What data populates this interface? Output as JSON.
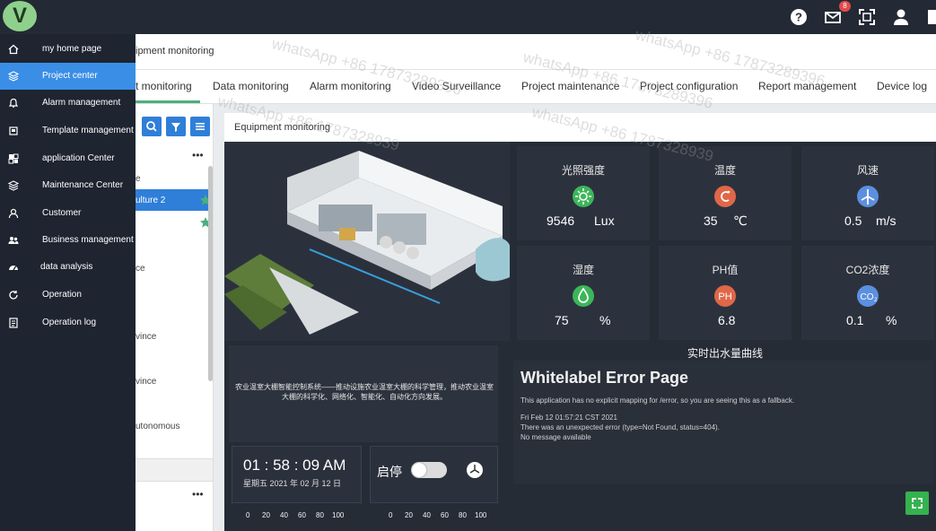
{
  "topbar": {
    "logo": "V",
    "mail_badge": "8",
    "icons": [
      "help-icon",
      "mail-icon",
      "fullscreen-icon",
      "user-icon"
    ]
  },
  "sidebar": {
    "items": [
      {
        "label": "my home page",
        "icon": "home-icon"
      },
      {
        "label": "Project center",
        "icon": "layers-icon",
        "active": true
      },
      {
        "label": "Alarm management",
        "icon": "bell-icon"
      },
      {
        "label": "Template management",
        "icon": "template-icon"
      },
      {
        "label": "application Center",
        "icon": "grid-icon"
      },
      {
        "label": "Maintenance Center",
        "icon": "stack-icon"
      },
      {
        "label": "Customer",
        "icon": "person-icon"
      },
      {
        "label": "Business management",
        "icon": "group-icon"
      },
      {
        "label": "data analysis",
        "icon": "dashboard-icon"
      },
      {
        "label": "Operation",
        "icon": "refresh-icon"
      },
      {
        "label": "Operation log",
        "icon": "log-icon"
      }
    ]
  },
  "breadcrumb": "ipment monitoring",
  "tabs": [
    {
      "label": "t monitoring",
      "active": true
    },
    {
      "label": "Data monitoring"
    },
    {
      "label": "Alarm monitoring"
    },
    {
      "label": "Video Surveillance"
    },
    {
      "label": "Project maintenance"
    },
    {
      "label": "Project configuration"
    },
    {
      "label": "Report management"
    },
    {
      "label": "Device log"
    }
  ],
  "tree": {
    "more": "•••",
    "items": [
      "e",
      "ulture 2",
      "ce",
      "vince",
      "vince",
      "utonomous"
    ]
  },
  "equipment": {
    "title": "Equipment monitoring",
    "scene_caption": "农业温室大棚智能控制系统——推动设施农业温室大棚的科学管理，推动农业温室大棚的科学化、网络化、智能化、自动化方向发展。",
    "sensors": [
      {
        "title": "光照强度",
        "value": "9546",
        "unit": "Lux",
        "icon": "sun-icon",
        "color": "#3cb65a"
      },
      {
        "title": "温度",
        "value": "35",
        "unit": "℃",
        "icon": "thermo-icon",
        "color": "#e06748"
      },
      {
        "title": "风速",
        "value": "0.5",
        "unit": "m/s",
        "icon": "windmill-icon",
        "color": "#5b8fe0"
      },
      {
        "title": "湿度",
        "value": "75",
        "unit": "%",
        "icon": "drop-icon",
        "color": "#3cb65a"
      },
      {
        "title": "PH值",
        "value": "6.8",
        "unit": "",
        "icon": "ph-icon",
        "color": "#e06748"
      },
      {
        "title": "CO2浓度",
        "value": "0.1",
        "unit": "%",
        "icon": "co2-icon",
        "color": "#5b8fe0"
      }
    ],
    "curve_title": "实时出水量曲线",
    "error": {
      "title": "Whitelabel Error Page",
      "lines": [
        "This application has no explicit mapping for /error, so you are seeing this as a fallback.",
        "Fri Feb 12 01:57:21 CST 2021",
        "There was an unexpected error (type=Not Found, status=404).",
        "No message available"
      ]
    },
    "clock": "01 : 58 : 09  AM",
    "date": "星期五    2021 年 02 月 12 日",
    "switch_label": "启停",
    "switch_on": false,
    "ticks": [
      "0",
      "20",
      "40",
      "60",
      "80",
      "100"
    ]
  },
  "watermarks": [
    "whatsApp +86 17873289396",
    "whatsApp +86 17873289396",
    "whatsApp +86 1787328939",
    "whatsApp +86 17873289396",
    "whatsApp +86 1787328939"
  ]
}
